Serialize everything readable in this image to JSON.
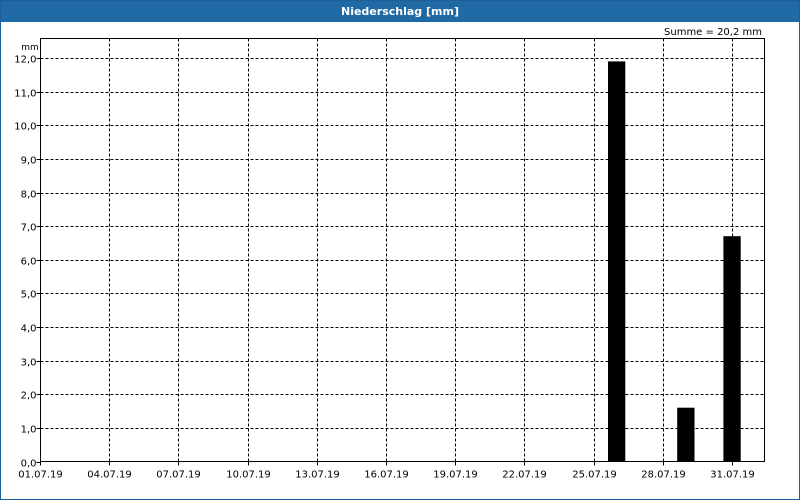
{
  "window": {
    "title": "Niederschlag [mm]"
  },
  "chart_data": {
    "type": "bar",
    "title": "Niederschlag [mm]",
    "unit_label": "mm",
    "summary": "Summe = 20,2 mm",
    "ylim": [
      0,
      12
    ],
    "y_ticks": [
      "0,0",
      "1,0",
      "2,0",
      "3,0",
      "4,0",
      "5,0",
      "6,0",
      "7,0",
      "8,0",
      "9,0",
      "10,0",
      "11,0",
      "12,0"
    ],
    "x_ticks": [
      "01.07.19",
      "04.07.19",
      "07.07.19",
      "10.07.19",
      "13.07.19",
      "16.07.19",
      "19.07.19",
      "22.07.19",
      "25.07.19",
      "28.07.19",
      "31.07.19"
    ],
    "grid": true,
    "bar_color": "#000000",
    "bars": [
      {
        "date": "26.07.19",
        "value": 11.9
      },
      {
        "date": "29.07.19",
        "value": 1.6
      },
      {
        "date": "31.07.19",
        "value": 6.7
      }
    ]
  }
}
